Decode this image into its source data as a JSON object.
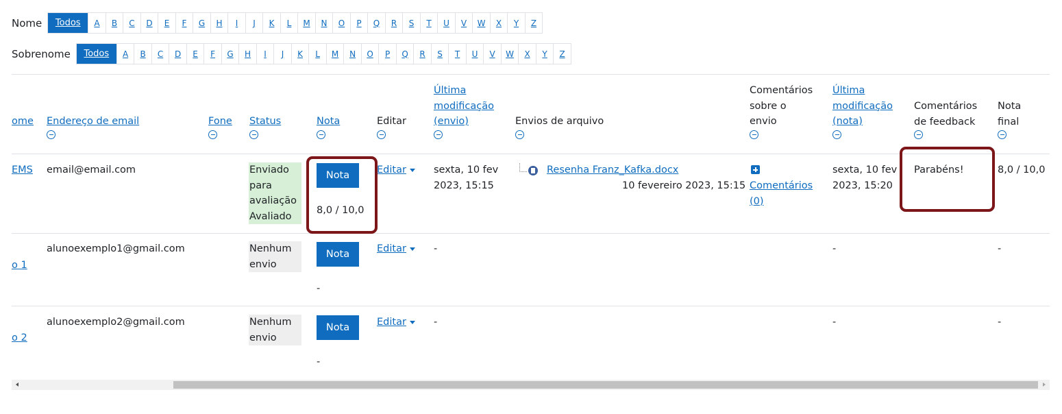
{
  "filters": {
    "first_name": {
      "label": "Nome",
      "all": "Todos"
    },
    "last_name": {
      "label": "Sobrenome",
      "all": "Todos"
    },
    "letters": [
      "A",
      "B",
      "C",
      "D",
      "E",
      "F",
      "G",
      "H",
      "I",
      "J",
      "K",
      "L",
      "M",
      "N",
      "O",
      "P",
      "Q",
      "R",
      "S",
      "T",
      "U",
      "V",
      "W",
      "X",
      "Y",
      "Z"
    ]
  },
  "columns": {
    "name": "ome",
    "email": "Endereço de email",
    "phone": "Fone",
    "status": "Status",
    "grade": "Nota",
    "edit": "Editar",
    "last_mod_sub_1": "Última",
    "last_mod_sub_2": "modificação",
    "last_mod_sub_3": "(envio)",
    "file_submissions": "Envios de arquivo",
    "sub_comments_1": "Comentários",
    "sub_comments_2": "sobre o",
    "sub_comments_3": "envio",
    "last_mod_grade_1": "Última",
    "last_mod_grade_2": "modificação",
    "last_mod_grade_3": "(nota)",
    "feedback_1": "Comentários",
    "feedback_2": "de feedback",
    "final_1": "Nota",
    "final_2": "final"
  },
  "rows": [
    {
      "name": "EMS",
      "email": "email@email.com",
      "status_1": "Enviado",
      "status_2": "para",
      "status_3": "avaliação",
      "status_4": "Avaliado",
      "grade_button": "Nota",
      "grade_value": "8,0 / 10,0",
      "edit": "Editar",
      "last_mod_sub_1": "sexta, 10 fev",
      "last_mod_sub_2": "2023, 15:15",
      "file_name": "Resenha Franz_Kafka.docx",
      "file_date": "10 fevereiro 2023, 15:15",
      "comments_link_1": "Comentários",
      "comments_link_2": "(0)",
      "last_mod_grade_1": "sexta, 10 fev",
      "last_mod_grade_2": "2023, 15:20",
      "feedback": "Parabéns!",
      "final_grade": "8,0 / 10,0"
    },
    {
      "name": "o 1",
      "email": "alunoexemplo1@gmail.com",
      "status_1": "Nenhum",
      "status_2": "envio",
      "grade_button": "Nota",
      "grade_value": "-",
      "edit": "Editar",
      "last_mod_sub": "-",
      "last_mod_grade": "-",
      "final_grade": "-"
    },
    {
      "name": "o 2",
      "email": "alunoexemplo2@gmail.com",
      "status_1": "Nenhum",
      "status_2": "envio",
      "grade_button": "Nota",
      "grade_value": "-",
      "edit": "Editar",
      "last_mod_sub": "-",
      "last_mod_grade": "-",
      "final_grade": "-"
    }
  ],
  "colors": {
    "link": "#0f6cbf",
    "status_submitted": "#d7efd6",
    "status_none": "#eeeeee",
    "highlight": "#7c1619"
  }
}
